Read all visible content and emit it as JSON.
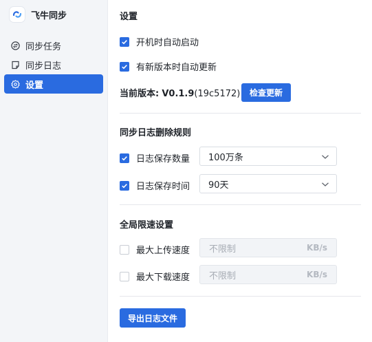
{
  "app": {
    "name": "飞牛同步",
    "logo_icon": "feiniu-sync-logo-icon"
  },
  "sidebar": {
    "items": [
      {
        "label": "同步任务",
        "icon": "sync-circle-icon"
      },
      {
        "label": "同步日志",
        "icon": "note-icon"
      },
      {
        "label": "设置",
        "icon": "gear-icon",
        "active": true
      }
    ]
  },
  "settings": {
    "title": "设置",
    "autostart": {
      "label": "开机时自动启动",
      "checked": true
    },
    "autoupdate": {
      "label": "有新版本时自动更新",
      "checked": true
    },
    "version_label": "当前版本:",
    "version_value": "V0.1.9",
    "version_build": "(19c5172)",
    "check_update": "检查更新"
  },
  "log_rules": {
    "title": "同步日志删除规则",
    "count": {
      "label": "日志保存数量",
      "checked": true,
      "value": "100万条"
    },
    "time": {
      "label": "日志保存时间",
      "checked": true,
      "value": "90天"
    }
  },
  "speed": {
    "title": "全局限速设置",
    "upload": {
      "label": "最大上传速度",
      "checked": false,
      "placeholder": "不限制",
      "unit": "KB/s"
    },
    "download": {
      "label": "最大下载速度",
      "checked": false,
      "placeholder": "不限制",
      "unit": "KB/s"
    }
  },
  "export_button": "导出日志文件",
  "colors": {
    "accent": "#2a6be0",
    "sidebar_bg": "#f3f5f8"
  }
}
